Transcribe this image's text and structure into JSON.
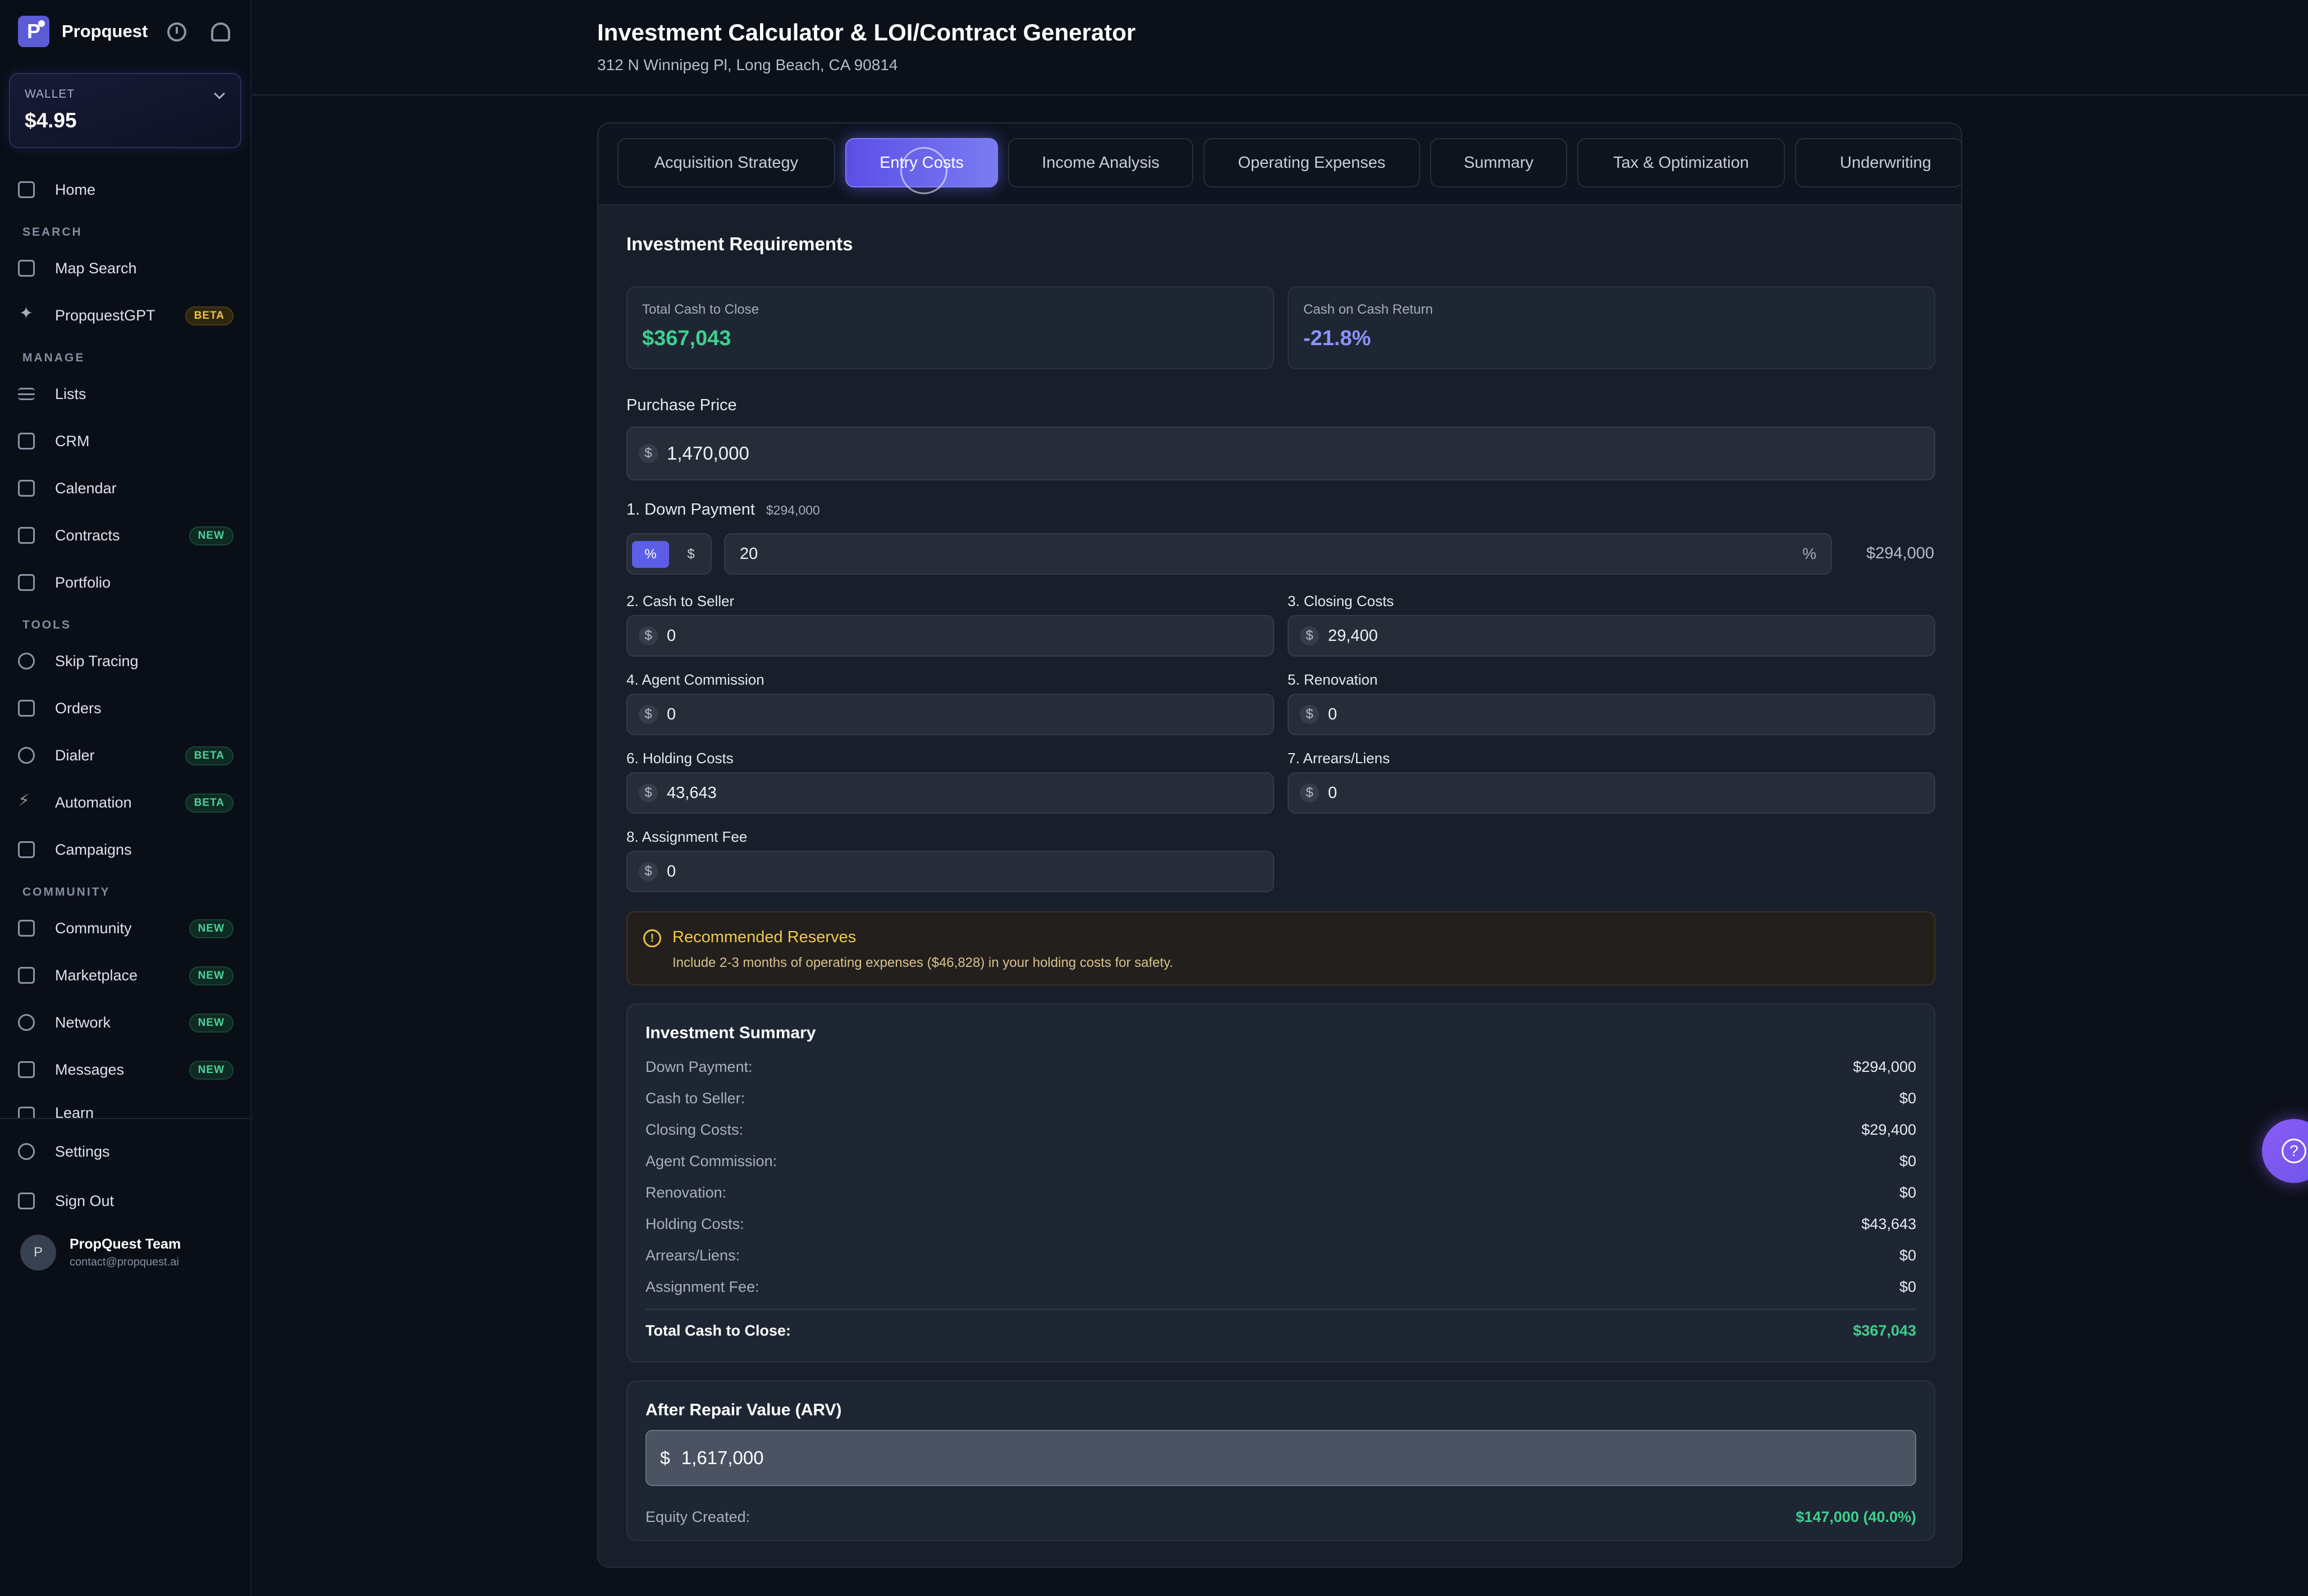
{
  "brand": {
    "name": "Propquest",
    "logo_letter": "P"
  },
  "wallet": {
    "label": "WALLET",
    "amount": "$4.95"
  },
  "nav": {
    "home": "Home",
    "section_search": "SEARCH",
    "map_search": "Map Search",
    "propquestgpt": "PropquestGPT",
    "section_manage": "MANAGE",
    "lists": "Lists",
    "crm": "CRM",
    "calendar": "Calendar",
    "contracts": "Contracts",
    "portfolio": "Portfolio",
    "section_tools": "TOOLS",
    "skip_tracing": "Skip Tracing",
    "orders": "Orders",
    "dialer": "Dialer",
    "automation": "Automation",
    "campaigns": "Campaigns",
    "section_community": "COMMUNITY",
    "community": "Community",
    "marketplace": "Marketplace",
    "network": "Network",
    "messages": "Messages",
    "learn": "Learn",
    "settings": "Settings",
    "sign_out": "Sign Out",
    "badge_beta": "BETA",
    "badge_new": "NEW"
  },
  "user": {
    "initial": "P",
    "name": "PropQuest Team",
    "email": "contact@propquest.ai"
  },
  "header": {
    "title": "Investment Calculator & LOI/Contract Generator",
    "subtitle": "312 N Winnipeg Pl, Long Beach, CA 90814"
  },
  "tabs": [
    {
      "label": "Acquisition Strategy"
    },
    {
      "label": "Entry Costs"
    },
    {
      "label": "Income Analysis"
    },
    {
      "label": "Operating Expenses"
    },
    {
      "label": "Summary"
    },
    {
      "label": "Tax & Optimization"
    },
    {
      "label": "Underwriting"
    }
  ],
  "requirements": {
    "title": "Investment Requirements",
    "total_cash_label": "Total Cash to Close",
    "total_cash_value": "$367,043",
    "coc_label": "Cash on Cash Return",
    "coc_value": "-21.8%"
  },
  "form": {
    "currency_symbol": "$",
    "purchase_price_label": "Purchase Price",
    "purchase_price": "1,470,000",
    "down_payment_label": "1. Down Payment",
    "down_payment_amount": "$294,000",
    "toggle_percent": "%",
    "toggle_dollar": "$",
    "down_payment_pct": "20",
    "down_payment_unit": "%",
    "down_payment_side": "$294,000",
    "cash_to_seller_label": "2. Cash to Seller",
    "cash_to_seller": "0",
    "closing_costs_label": "3. Closing Costs",
    "closing_costs": "29,400",
    "agent_commission_label": "4. Agent Commission",
    "agent_commission": "0",
    "renovation_label": "5. Renovation",
    "renovation": "0",
    "holding_costs_label": "6. Holding Costs",
    "holding_costs": "43,643",
    "arrears_label": "7. Arrears/Liens",
    "arrears": "0",
    "assignment_fee_label": "8. Assignment Fee",
    "assignment_fee": "0"
  },
  "alert": {
    "icon": "!",
    "title": "Recommended Reserves",
    "body": "Include 2-3 months of operating expenses ($46,828) in your holding costs for safety."
  },
  "summary": {
    "title": "Investment Summary",
    "rows": [
      {
        "label": "Down Payment:",
        "value": "$294,000"
      },
      {
        "label": "Cash to Seller:",
        "value": "$0"
      },
      {
        "label": "Closing Costs:",
        "value": "$29,400"
      },
      {
        "label": "Agent Commission:",
        "value": "$0"
      },
      {
        "label": "Renovation:",
        "value": "$0"
      },
      {
        "label": "Holding Costs:",
        "value": "$43,643"
      },
      {
        "label": "Arrears/Liens:",
        "value": "$0"
      },
      {
        "label": "Assignment Fee:",
        "value": "$0"
      }
    ],
    "total_label": "Total Cash to Close:",
    "total_value": "$367,043"
  },
  "arv": {
    "title": "After Repair Value (ARV)",
    "currency_symbol": "$",
    "value": "1,617,000",
    "equity_label": "Equity Created:",
    "equity_value": "$147,000 (40.0%)"
  },
  "help": {
    "icon": "?"
  },
  "colors": {
    "accent": "#5b5bd6",
    "positive": "#3fcf8e",
    "negative_metric": "#8c93ff",
    "warning": "#efc94d"
  }
}
